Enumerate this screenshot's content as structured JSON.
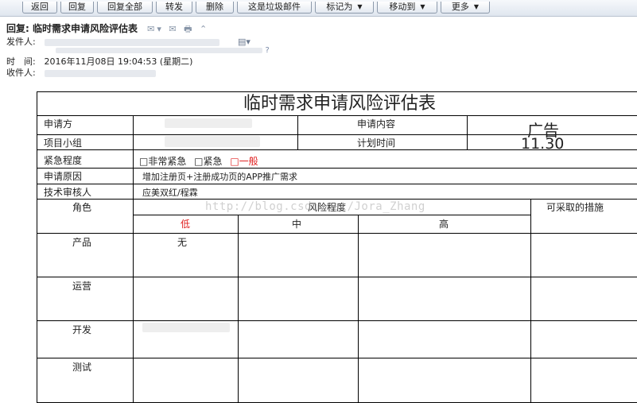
{
  "toolbar": {
    "back": "返回",
    "reply": "回复",
    "reply_all": "回复全部",
    "forward": "转发",
    "delete": "删除",
    "spam": "这是垃圾邮件",
    "mark_as": "标记为",
    "move_to": "移动到",
    "more": "更多"
  },
  "email": {
    "subject": "回复: 临时需求申请风险评估表",
    "icons": "✉▾ ✉ 🖶 ⌃",
    "from_label": "发件人:",
    "time_label": "时　间:",
    "time_value": "2016年11月08日 19:04:53 (星期二)",
    "to_label": "收件人:"
  },
  "form": {
    "title": "临时需求申请风险评估表",
    "applicant_label": "申请方",
    "content_label": "申请内容",
    "content_value": "广告",
    "group_label": "项目小组",
    "plan_time_label": "计划时间",
    "plan_time_value": "11.30",
    "urgency_label": "紧急程度",
    "urgency_options": {
      "very_urgent": "□非常紧急",
      "urgent": "□紧急",
      "normal": "□一般"
    },
    "reason_label": "申请原因",
    "reason_value": "增加注册页+注册成功页的APP推广需求",
    "reviewer_label": "技术审核人",
    "reviewer_value": "应美双红/程霖",
    "role_header": "角色",
    "risk_header": "风险程度",
    "measures_header": "可采取的措施",
    "risk_low": "低",
    "risk_mid": "中",
    "risk_high": "高",
    "rows": [
      {
        "role": "产品",
        "low": "无"
      },
      {
        "role": "运营",
        "low": ""
      },
      {
        "role": "开发",
        "low": ""
      },
      {
        "role": "测试",
        "low": ""
      }
    ]
  },
  "watermark": "http://blog.csdn.net/Jora_Zhang"
}
